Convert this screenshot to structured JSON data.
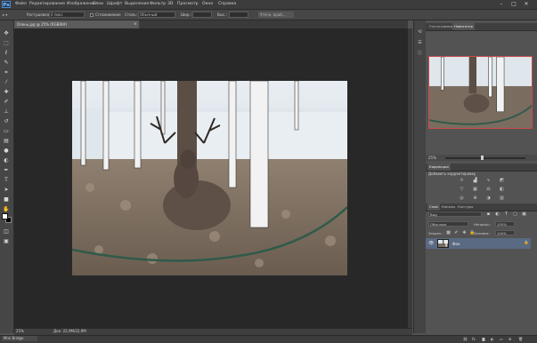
{
  "app": {
    "logo": "Ps"
  },
  "menubar": {
    "items": [
      "Файл",
      "Редактирование",
      "Изображение",
      "Слои",
      "Шрифт",
      "Выделение",
      "Фильтр",
      "3D",
      "Просмотр",
      "Окно",
      "Справка"
    ]
  },
  "window_controls": {
    "minimize": "–",
    "maximize": "□",
    "close": "✕"
  },
  "options_bar": {
    "tool_label": "▸ ▾",
    "feather_label": "Растушевка:",
    "feather_value": "0 пикс",
    "antialias_label": "Сглаживание",
    "style_label": "Стиль:",
    "style_value": "Обычный",
    "width_label": "Шир.:",
    "height_label": "Выс.:",
    "refine_label": "Уточн. край..."
  },
  "document": {
    "tab_title": "Олень.jpg @ 25% (RGB/8#)",
    "close": "×",
    "zoom": "25%",
    "info": "Док: 22,9M/22,9M"
  },
  "bottom_tab": "Mini Bridge",
  "panels": {
    "navigator_tabs": [
      "Гистограмма",
      "Навигатор"
    ],
    "navigator_zoom": "25%",
    "adjustments_tabs": [
      "Коррекция"
    ],
    "adjustments_title": "Добавить корректировку",
    "layers_tabs": [
      "Слои",
      "Каналы",
      "Контуры"
    ],
    "layers_kind": "Вид",
    "blend_mode": "Обычные",
    "opacity_label": "Непрозр.:",
    "opacity_value": "100%",
    "lock_label": "Закреп.:",
    "fill_label": "Заливка:",
    "fill_value": "100%",
    "layer_name": "Фон"
  },
  "icons": [
    "move-icon",
    "marquee-icon",
    "lasso-icon",
    "quick-select-icon",
    "crop-icon",
    "eyedropper-icon",
    "healing-icon",
    "brush-icon",
    "stamp-icon",
    "history-brush-icon",
    "eraser-icon",
    "gradient-icon",
    "blur-icon",
    "dodge-icon",
    "pen-icon",
    "type-icon",
    "path-select-icon",
    "shape-icon",
    "hand-icon",
    "zoom-icon"
  ]
}
